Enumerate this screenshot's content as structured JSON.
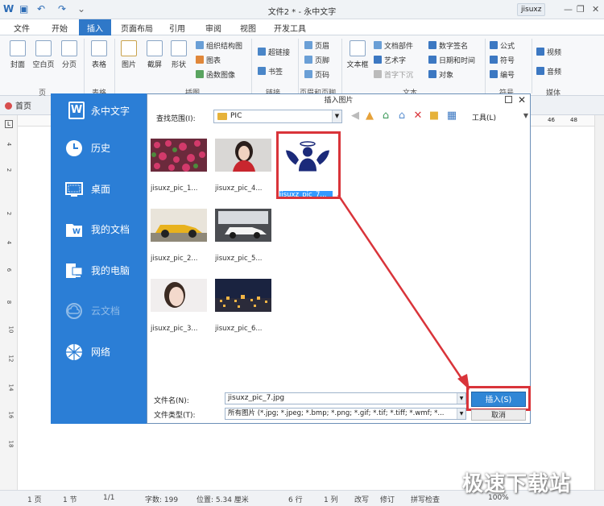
{
  "app": {
    "doc_title": "文件2 * - 永中文字",
    "user": "jisuxz",
    "tabs": [
      "文件",
      "开始",
      "插入",
      "页面布局",
      "引用",
      "审阅",
      "视图",
      "开发工具"
    ],
    "active_tab": "插入",
    "ribbon": {
      "large_buttons": [
        "封面",
        "空白页",
        "分页",
        "表格",
        "图片",
        "截屏",
        "形状",
        "文本框",
        "视频",
        "音频"
      ],
      "small_buttons": [
        "组织结构图",
        "图表",
        "函数图像",
        "超链接",
        "书签",
        "页眉",
        "页脚",
        "页码",
        "文档部件",
        "艺术字",
        "首字下沉",
        "数字签名",
        "日期和时间",
        "对象",
        "公式",
        "符号",
        "编号"
      ],
      "group_labels": [
        "页",
        "表格",
        "插图",
        "链接",
        "页眉和页脚",
        "文本",
        "符号",
        "媒体"
      ]
    },
    "home_tab": "首页",
    "ruler_numbers": [
      "46",
      "48"
    ],
    "left_ruler_numbers": [
      "4",
      "2",
      "2",
      "4",
      "6",
      "8",
      "10",
      "12",
      "14",
      "16",
      "18"
    ]
  },
  "sidebar": {
    "brand": "永中文字",
    "logo_letter": "W",
    "items": [
      {
        "label": "历史",
        "icon": "clock-icon",
        "disabled": false
      },
      {
        "label": "桌面",
        "icon": "desktop-icon",
        "disabled": false
      },
      {
        "label": "我的文档",
        "icon": "documents-icon",
        "disabled": false
      },
      {
        "label": "我的电脑",
        "icon": "computer-icon",
        "disabled": false
      },
      {
        "label": "云文档",
        "icon": "cloud-icon",
        "disabled": true
      },
      {
        "label": "网络",
        "icon": "network-icon",
        "disabled": false
      }
    ]
  },
  "dialog": {
    "title": "插入图片",
    "lookin_label": "查找范围(I):",
    "lookin_value": "PIC",
    "tools_label": "工具(L)",
    "files": [
      {
        "name": "jisuxz_pic_1...",
        "thumb": "flowers"
      },
      {
        "name": "jisuxz_pic_4...",
        "thumb": "woman-red"
      },
      {
        "name": "jisuxz_pic_7...",
        "thumb": "angel-logo",
        "selected": true
      },
      {
        "name": "jisuxz_pic_2...",
        "thumb": "car-yellow"
      },
      {
        "name": "jisuxz_pic_5...",
        "thumb": "car-white"
      },
      {
        "name": "jisuxz_pic_3...",
        "thumb": "woman-face"
      },
      {
        "name": "jisuxz_pic_6...",
        "thumb": "night-city"
      }
    ],
    "filename_label": "文件名(N):",
    "filename_value": "jisuxz_pic_7.jpg",
    "filetype_label": "文件类型(T):",
    "filetype_value": "所有图片 (*.jpg; *.jpeg; *.bmp; *.png; *.gif; *.tif; *.tiff; *.wmf; *...",
    "insert_label": "插入(S)",
    "cancel_label": "取消"
  },
  "status": {
    "page": "1 页",
    "section": "1 节",
    "pages": "1/1",
    "chars": "字数: 199",
    "position": "位置: 5.34 厘米",
    "row": "6 行",
    "col": "1 列",
    "rev": "改写",
    "revise": "修订",
    "spell": "拼写检查",
    "zoom": "100%"
  },
  "watermark": "极速下载站",
  "colors": {
    "accent": "#2f78c8",
    "sidebar": "#2b7ed6",
    "highlight": "#d9343a"
  }
}
